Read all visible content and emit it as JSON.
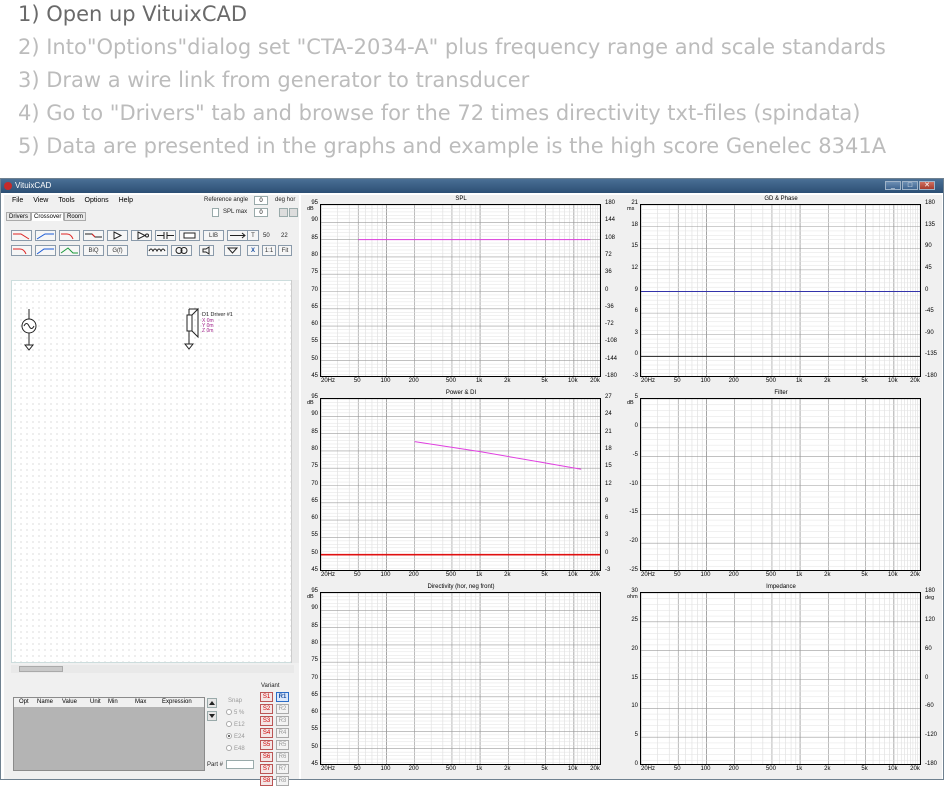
{
  "steps": [
    "1) Open up VituixCAD",
    "2) Into\"Options\"dialog set \"CTA-2034-A\" plus frequency range and scale standards",
    "3) Draw a wire link from generator to transducer",
    "4) Go to \"Drivers\" tab and browse for the 72 times directivity txt-files (spindata)",
    "5) Data are presented in the graphs and example is the high score Genelec 8341A"
  ],
  "window": {
    "title": "VituixCAD",
    "buttons": [
      "_",
      "□",
      "✕"
    ]
  },
  "menu": [
    "File",
    "View",
    "Tools",
    "Options",
    "Help"
  ],
  "reference": {
    "angle_label": "Reference angle",
    "angle_value": "0",
    "angle_unit": "deg hor",
    "spl_max_label": "SPL max",
    "spl_max_value": "0"
  },
  "tabs": [
    "Drivers",
    "Crossover",
    "Room"
  ],
  "active_tab": "Crossover",
  "toolbar": {
    "row1": [
      "LIB",
      "T",
      "50",
      "22"
    ],
    "row2": [
      "BiQ",
      "G(f)",
      "X",
      "1:1",
      "Fit"
    ]
  },
  "driver_block": {
    "name": "D1 Driver #1",
    "x": "X 0m",
    "y": "Y 0m",
    "z": "Z 0m"
  },
  "parts_table": {
    "headers": [
      "Opt",
      "Name",
      "Value",
      "Unit",
      "Min",
      "Max",
      "Expression"
    ]
  },
  "snap": {
    "label": "Snap",
    "options": [
      "5 %",
      "E12",
      "E24",
      "E48"
    ],
    "selected": "E24"
  },
  "part_label": "Part #",
  "variant": {
    "label": "Variant",
    "s_buttons": [
      "S1",
      "S2",
      "S3",
      "S4",
      "S5",
      "S6",
      "S7",
      "S8"
    ],
    "r_buttons": [
      "R1",
      "R2",
      "R3",
      "R4",
      "R5",
      "R6",
      "R7",
      "R8"
    ],
    "active": "R1"
  },
  "colors": {
    "magenta": "#e040e0",
    "red": "#e01010",
    "blue": "#3333aa"
  },
  "x_ticks": [
    "20Hz",
    "50",
    "100",
    "200",
    "500",
    "1k",
    "2k",
    "5k",
    "10k",
    "20k"
  ],
  "graphs": [
    {
      "id": "spl",
      "title": "SPL",
      "left_unit": "dB",
      "left_ticks": [
        "95",
        "90",
        "85",
        "80",
        "75",
        "70",
        "65",
        "60",
        "55",
        "50",
        "45"
      ],
      "right_unit": "",
      "right_ticks": [
        "180",
        "144",
        "108",
        "72",
        "36",
        "0",
        "-36",
        "-72",
        "-108",
        "-144",
        "-180"
      ],
      "ylim": [
        45,
        95
      ],
      "lines": [
        {
          "color": "#e040e0",
          "points": [
            [
              50,
              85.0
            ],
            [
              15000,
              85.0
            ]
          ]
        }
      ]
    },
    {
      "id": "gd_phase",
      "title": "GD & Phase",
      "left_unit": "ms",
      "left_ticks": [
        "21",
        "18",
        "15",
        "12",
        "9",
        "6",
        "3",
        "0",
        "-3"
      ],
      "right_unit": "",
      "right_ticks": [
        "180",
        "135",
        "90",
        "45",
        "0",
        "-45",
        "-90",
        "-135",
        "-180"
      ],
      "ylim": [
        -3,
        21
      ],
      "lines": [
        {
          "color": "#3333aa",
          "points": [
            [
              20,
              9
            ],
            [
              20000,
              9
            ]
          ]
        },
        {
          "color": "#222222",
          "points": [
            [
              20,
              0
            ],
            [
              20000,
              0
            ]
          ]
        }
      ]
    },
    {
      "id": "power_di",
      "title": "Power & DI",
      "left_unit": "dB",
      "left_ticks": [
        "95",
        "90",
        "85",
        "80",
        "75",
        "70",
        "65",
        "60",
        "55",
        "50",
        "45"
      ],
      "right_unit": "",
      "right_ticks": [
        "27",
        "24",
        "21",
        "18",
        "15",
        "12",
        "9",
        "6",
        "3",
        "0",
        "-3"
      ],
      "ylim": [
        45,
        95
      ],
      "lines": [
        {
          "color": "#e040e0",
          "points": [
            [
              200,
              82.7
            ],
            [
              1000,
              79.8
            ],
            [
              5000,
              76.5
            ],
            [
              12000,
              74.7
            ]
          ]
        },
        {
          "color": "#e01010",
          "points": [
            [
              20,
              50
            ],
            [
              20000,
              50
            ]
          ],
          "width": 1.6
        }
      ]
    },
    {
      "id": "filter",
      "title": "Filter",
      "left_unit": "dB",
      "left_ticks": [
        "5",
        "0",
        "-5",
        "-10",
        "-15",
        "-20",
        "-25"
      ],
      "right_unit": "",
      "right_ticks": [],
      "ylim": [
        -25,
        5
      ],
      "lines": []
    },
    {
      "id": "directivity",
      "title": "Directivity (hor, neg front)",
      "left_unit": "dB",
      "left_ticks": [
        "95",
        "90",
        "85",
        "80",
        "75",
        "70",
        "65",
        "60",
        "55",
        "50",
        "45"
      ],
      "right_unit": "",
      "right_ticks": [],
      "ylim": [
        45,
        95
      ],
      "lines": []
    },
    {
      "id": "impedance",
      "title": "Impedance",
      "left_unit": "ohm",
      "left_ticks": [
        "30",
        "25",
        "20",
        "15",
        "10",
        "5",
        "0"
      ],
      "right_unit": "deg",
      "right_ticks": [
        "180",
        "120",
        "60",
        "0",
        "-60",
        "-120",
        "-180"
      ],
      "ylim": [
        0,
        30
      ],
      "lines": []
    }
  ]
}
